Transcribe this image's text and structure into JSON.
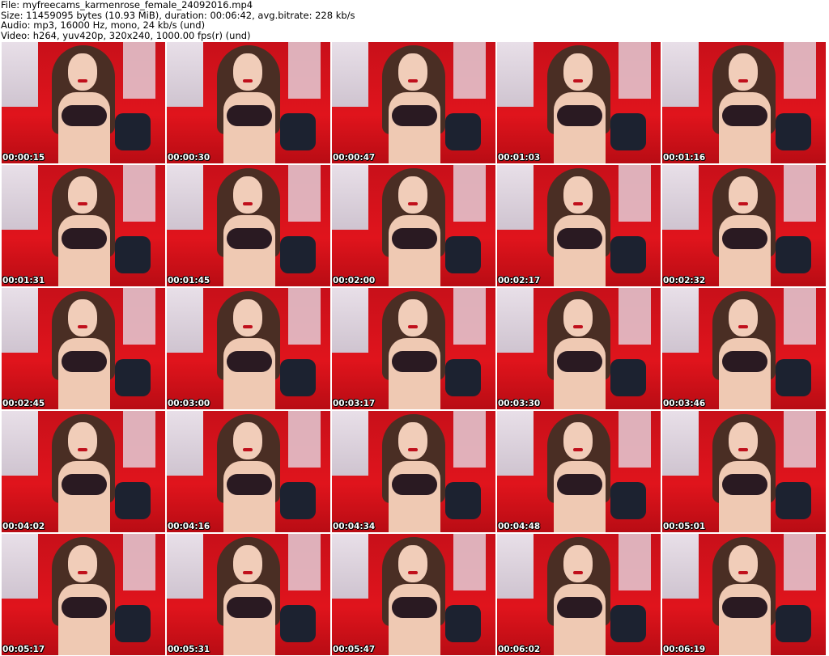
{
  "header": {
    "file": "File: myfreecams_karmenrose_female_24092016.mp4",
    "size": "Size: 11459095 bytes (10.93 MiB), duration: 00:06:42, avg.bitrate: 228 kb/s",
    "audio": "Audio: mp3, 16000 Hz, mono, 24 kb/s (und)",
    "video": "Video: h264, yuv420p, 320x240, 1000.00 fps(r) (und)"
  },
  "thumbnails": [
    "00:00:15",
    "00:00:30",
    "00:00:47",
    "00:01:03",
    "00:01:16",
    "00:01:31",
    "00:01:45",
    "00:02:00",
    "00:02:17",
    "00:02:32",
    "00:02:45",
    "00:03:00",
    "00:03:17",
    "00:03:30",
    "00:03:46",
    "00:04:02",
    "00:04:16",
    "00:04:34",
    "00:04:48",
    "00:05:01",
    "00:05:17",
    "00:05:31",
    "00:05:47",
    "00:06:02",
    "00:06:19"
  ]
}
